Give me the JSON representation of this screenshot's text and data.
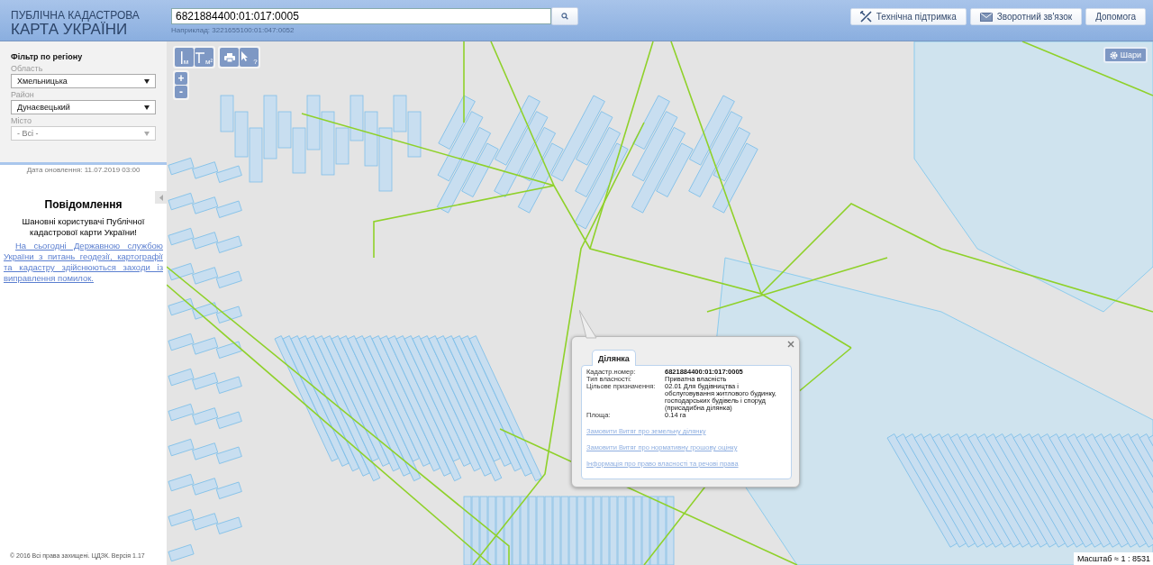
{
  "header": {
    "logo_line_1": "ПУБЛІЧНА КАДАСТРОВА",
    "logo_line_2": "КАРТА УКРАЇНИ",
    "search": {
      "value": "6821884400:01:017:0005",
      "hint": "Наприклад: 3221655100:01:047:0052"
    },
    "buttons": [
      {
        "kind": "support",
        "label": "Технічна підтримка"
      },
      {
        "kind": "feedback",
        "label": "Зворотний зв'язок"
      },
      {
        "kind": "help",
        "label": "Допомога"
      }
    ]
  },
  "sidebar": {
    "filter_title": "Фільтр по регіону",
    "filters": [
      {
        "label": "Область",
        "value": "Хмельницька",
        "disabled": false
      },
      {
        "label": "Район",
        "value": "Дунаєвецький",
        "disabled": false
      },
      {
        "label": "Місто",
        "value": "- Всі -",
        "disabled": true
      }
    ],
    "update_date": "Дата оновлення: 11.07.2019 03:00",
    "notice_title": "Повідомлення",
    "notice_greeting": "Шановні користувачі Публічної кадастрової карти України!",
    "notice_link": "На сьогодні Державною службою України з питань геодезії, картографії та кадастру здійснюються заходи із виправлення помилок.",
    "footer": "© 2016 Всі права захищені. ЦДЗК. Версія 1.17"
  },
  "map": {
    "tools": [
      {
        "kind": "distance",
        "unit": "м"
      },
      {
        "kind": "area",
        "unit": "м²"
      },
      {
        "kind": "print"
      },
      {
        "kind": "identify",
        "unit": "?"
      }
    ],
    "zoom": [
      "+",
      "-"
    ],
    "layers_button": "Шари",
    "scale": "Масштаб ≈ 1 : 8531",
    "popup": {
      "tabs": [
        {
          "label": "Ділянка",
          "selected": true
        }
      ],
      "fields": [
        {
          "label": "Кадастр.номер:",
          "value": "6821884400:01:017:0005",
          "bold": true
        },
        {
          "label": "Тип власності:",
          "value": "Приватна власність",
          "bold": false
        },
        {
          "label": "Цільове призначення:",
          "value": "02.01 Для будівництва і обслуговування житлового будинку, господарських будівель і споруд (присадибна ділянка)",
          "bold": false
        },
        {
          "label": "Площа:",
          "value": "0.14 га",
          "bold": false
        }
      ],
      "links": [
        "Замовити Витяг про земельну ділянку",
        "Замовити Витяг про нормативну грошову оцінку",
        "Інформація про право власності та речові права"
      ]
    }
  }
}
